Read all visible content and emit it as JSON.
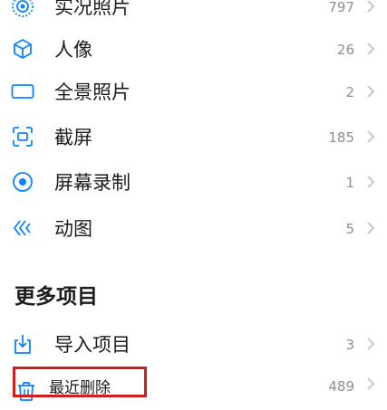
{
  "media_types": [
    {
      "label": "实况照片",
      "count": "797",
      "icon": "live-photo-icon"
    },
    {
      "label": "人像",
      "count": "26",
      "icon": "portrait-cube-icon"
    },
    {
      "label": "全景照片",
      "count": "2",
      "icon": "panorama-icon"
    },
    {
      "label": "截屏",
      "count": "185",
      "icon": "screenshot-icon"
    },
    {
      "label": "屏幕录制",
      "count": "1",
      "icon": "screen-recording-icon"
    },
    {
      "label": "动图",
      "count": "5",
      "icon": "animated-icon"
    }
  ],
  "more_items": {
    "title": "更多项目",
    "rows": [
      {
        "label": "导入项目",
        "count": "3",
        "icon": "import-icon"
      },
      {
        "label": "最近删除",
        "count": "489",
        "icon": "trash-icon"
      }
    ]
  },
  "colors": {
    "accent": "#0a84ff",
    "secondary_text": "#8e8e93",
    "chevron": "#c7c7cc",
    "highlight": "#d01e1e"
  }
}
